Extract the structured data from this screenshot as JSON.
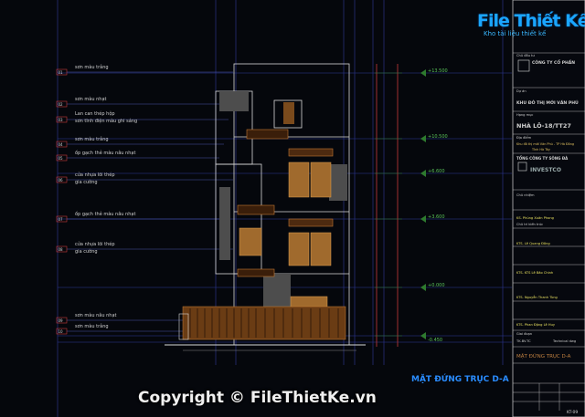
{
  "brand": {
    "name": "File Thiết Kế.vn",
    "subtitle": "Kho tài liệu thiết kế"
  },
  "copyright": "Copyright © FileThietKe.vn",
  "drawing_title": "MẶT ĐỨNG TRỤC D-A",
  "labels": [
    {
      "tag": "01",
      "text": "sơn màu trắng"
    },
    {
      "tag": "02",
      "text": "sơn màu nhạt"
    },
    {
      "tag": "03",
      "text": "Lan can thép hộp"
    },
    {
      "tag": "",
      "text": "sơn tĩnh điện màu ghi sáng"
    },
    {
      "tag": "04",
      "text": "sơn màu trắng"
    },
    {
      "tag": "05",
      "text": "ốp gạch thẻ màu nâu nhạt"
    },
    {
      "tag": "06",
      "text": "cửa nhựa lõi thép"
    },
    {
      "tag": "",
      "text": "gia cường"
    },
    {
      "tag": "07",
      "text": "ốp gạch thẻ màu nâu nhạt"
    },
    {
      "tag": "08",
      "text": "cửa nhựa lõi thép"
    },
    {
      "tag": "",
      "text": "gia cường"
    },
    {
      "tag": "09",
      "text": "sơn màu nâu nhạt"
    },
    {
      "tag": "10",
      "text": "sơn màu trắng"
    }
  ],
  "levels": [
    "+13.500",
    "+10.500",
    "+6.600",
    "+3.600",
    "+0.000",
    "-0.450"
  ],
  "title_block": {
    "rows": [
      "Chủ đầu tư",
      "CÔNG TY CỔ PHẦN",
      "Dự án",
      "KHU ĐÔ THỊ MỚI VĂN PHÚ",
      "Hạng mục",
      "NHÀ LÔ-18/TT27",
      "Địa điểm",
      "Khu đô thị mới Văn Phú - TP Hà Đông",
      "Tỉnh Hà Tây",
      "TỔNG CÔNG TY SÔNG ĐÀ",
      "INVESTCO",
      "Chủ nhiệm",
      "KS. Phùng Xuân Phong",
      "Chủ trì kiến trúc",
      "KTS. Lê Quang Đông",
      "KTS. KTS Lê Bảo Chinh",
      "KTS. Nguyễn Thanh Tùng",
      "KTS. Phan Đặng Lê Huy",
      "Giai đoạn",
      "TK.BV.TC",
      "Technical dwg"
    ],
    "sheet_title": "MẶT ĐỨNG TRỤC D-A",
    "sheet_no": "KT-09"
  }
}
